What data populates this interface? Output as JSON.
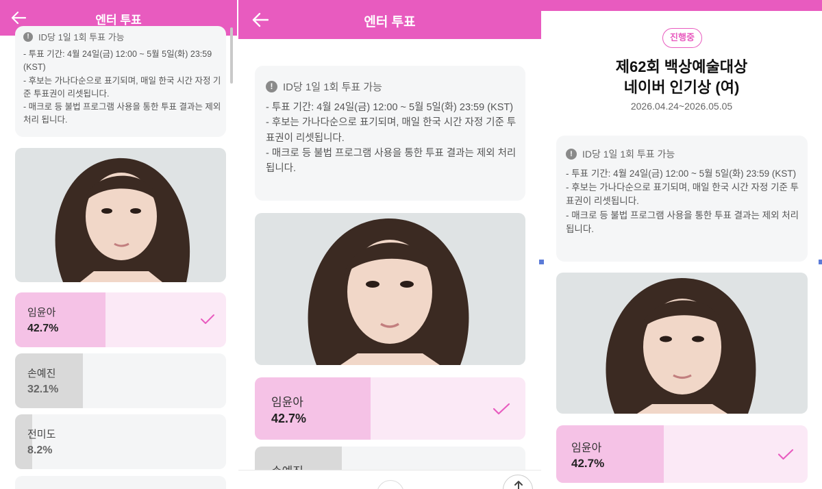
{
  "header": {
    "title": "엔터 투표"
  },
  "notice": {
    "head": "ID당 1일 1회 투표 가능",
    "lines": [
      "- 투표 기간: 4월 24일(금) 12:00 ~ 5월 5일(화) 23:59 (KST)",
      "- 후보는 가나다순으로 표기되며, 매일 한국 시간 자정 기준 투표권이 리셋됩니다.",
      "- 매크로 등 불법 프로그램 사용을 통한 투표 결과는 제외 처리 됩니다."
    ]
  },
  "vote": {
    "status": "진행중",
    "title_line1": "제62회 백상예술대상",
    "title_line2": "네이버 인기상 (여)",
    "dates": "2026.04.24~2026.05.05"
  },
  "candidates": [
    {
      "name": "임윤아",
      "percent_label": "42.7%",
      "percent": 42.7,
      "selected": true
    },
    {
      "name": "손예진",
      "percent_label": "32.1%",
      "percent": 32.1,
      "selected": false
    },
    {
      "name": "전미도",
      "percent_label": "8.2%",
      "percent": 8.2,
      "selected": false
    }
  ],
  "colors": {
    "brand": "#e85bbf",
    "selected_fill": "#f5c2e6",
    "selected_bg": "#fbe9f6",
    "other_fill": "#d9d9d9"
  },
  "icons": {
    "back": "arrow-left-icon",
    "notice": "exclamation-icon",
    "check": "check-icon",
    "share": "share-icon"
  }
}
